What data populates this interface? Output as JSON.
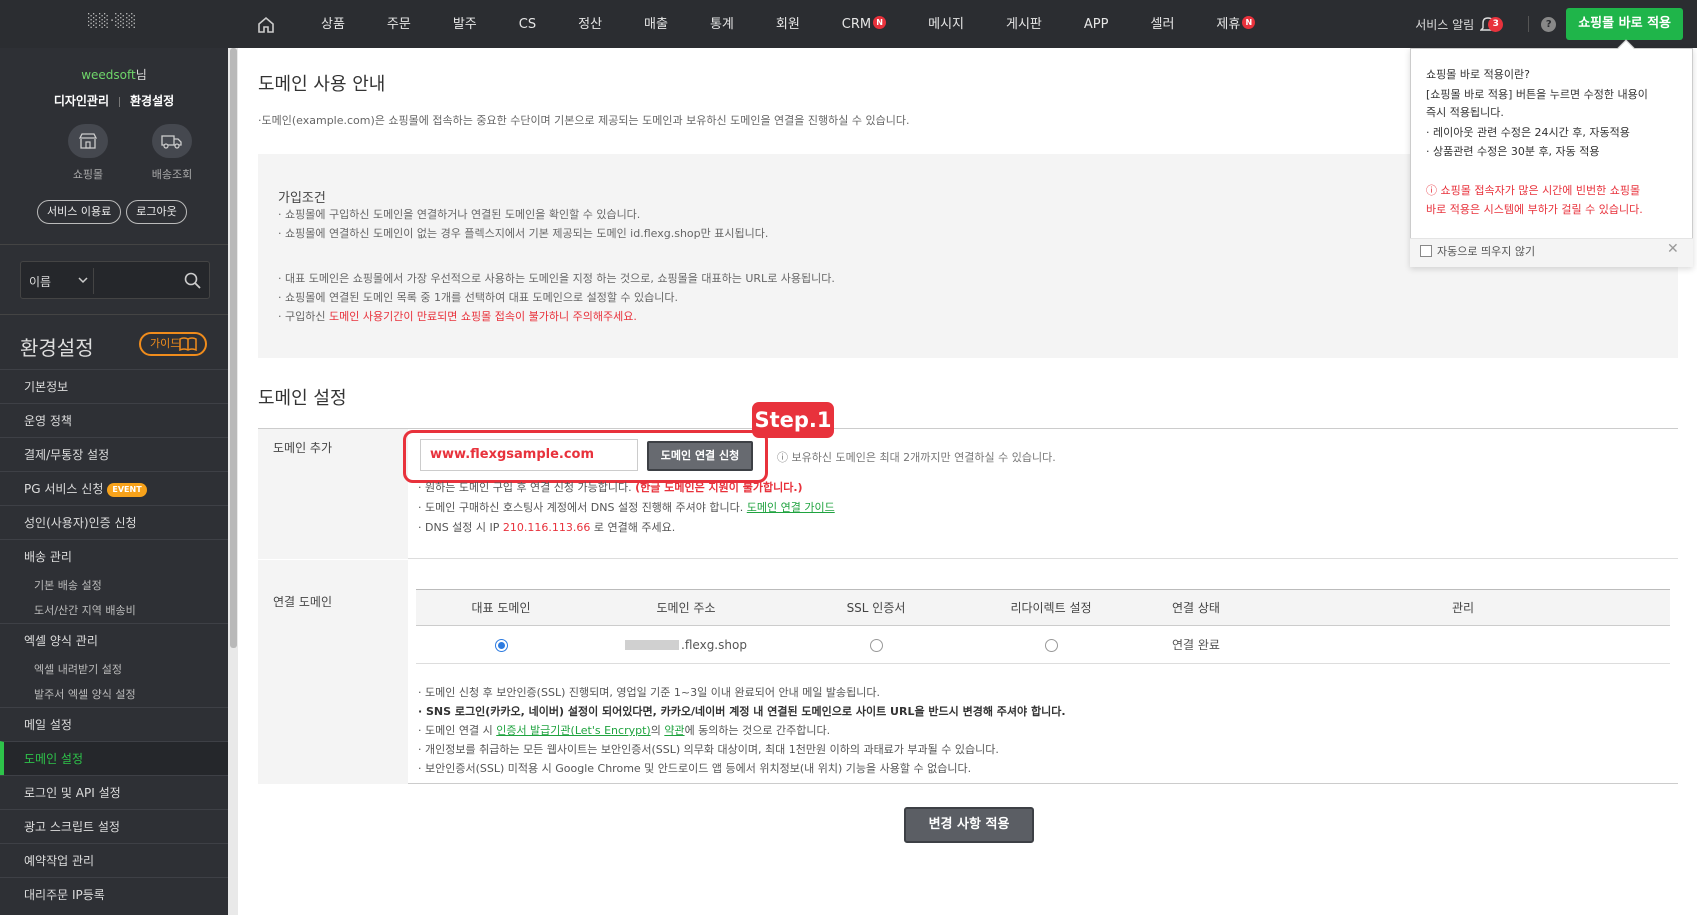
{
  "topbar": {
    "logo": "░░·░░",
    "nav": [
      {
        "label": "상품",
        "badge": ""
      },
      {
        "label": "주문",
        "badge": ""
      },
      {
        "label": "발주",
        "badge": ""
      },
      {
        "label": "CS",
        "badge": ""
      },
      {
        "label": "정산",
        "badge": ""
      },
      {
        "label": "매출",
        "badge": ""
      },
      {
        "label": "통계",
        "badge": ""
      },
      {
        "label": "회원",
        "badge": ""
      },
      {
        "label": "CRM",
        "badge": "N"
      },
      {
        "label": "메시지",
        "badge": ""
      },
      {
        "label": "게시판",
        "badge": ""
      },
      {
        "label": "APP",
        "badge": ""
      },
      {
        "label": "셀러",
        "badge": ""
      },
      {
        "label": "제휴",
        "badge": "N"
      }
    ],
    "service_alert": "서비스 알림",
    "alert_count": "3",
    "help": "?",
    "apply_label": "쇼핑몰 바로 적용"
  },
  "sidebar": {
    "user_name": "weedsoft",
    "user_suffix": "님",
    "link_design": "디자인관리",
    "link_settings": "환경설정",
    "icon_shop": "쇼핑몰",
    "icon_delivery": "배송조회",
    "btn_service": "서비스 이용료",
    "btn_logout": "로그아웃",
    "search_select": "이름",
    "section_title": "환경설정",
    "guide_label": "가이드",
    "menu": [
      {
        "label": "기본정보",
        "type": "main",
        "event": ""
      },
      {
        "label": "운영 정책",
        "type": "main",
        "event": ""
      },
      {
        "label": "결제/무통장 설정",
        "type": "main",
        "event": ""
      },
      {
        "label": "PG 서비스 신청",
        "type": "main",
        "event": "EVENT"
      },
      {
        "label": "성인(사용자)인증 신청",
        "type": "main",
        "event": ""
      },
      {
        "label": "배송 관리",
        "type": "main",
        "event": ""
      },
      {
        "label": "기본 배송 설정",
        "type": "sub",
        "event": ""
      },
      {
        "label": "도서/산간 지역 배송비",
        "type": "sub",
        "event": ""
      },
      {
        "label": "엑셀 양식 관리",
        "type": "main",
        "event": ""
      },
      {
        "label": "엑셀 내려받기 설정",
        "type": "sub",
        "event": ""
      },
      {
        "label": "발주서 엑셀 양식 설정",
        "type": "sub",
        "event": ""
      },
      {
        "label": "메일 설정",
        "type": "main",
        "event": ""
      },
      {
        "label": "도메인 설정",
        "type": "active",
        "event": ""
      },
      {
        "label": "로그인 및 API 설정",
        "type": "main",
        "event": ""
      },
      {
        "label": "광고 스크립트 설정",
        "type": "main",
        "event": ""
      },
      {
        "label": "예약작업 관리",
        "type": "main",
        "event": ""
      },
      {
        "label": "대리주문 IP등록",
        "type": "main",
        "event": ""
      }
    ]
  },
  "guide": {
    "title": "도메인 사용 안내",
    "desc": "·도메인(example.com)은 쇼핑몰에 접속하는 중요한 수단이며 기본으로 제공되는 도메인과 보유하신 도메인을 연결을 진행하실 수 있습니다.",
    "box_title": "가입조건",
    "lines": [
      "· 쇼핑몰에 구입하신 도메인을 연결하거나 연결된 도메인을 확인할 수 있습니다.",
      "· 쇼핑몰에 연결하신 도메인이 없는 경우 플렉스지에서 기본 제공되는 도메인 id.flexg.shop만 표시됩니다.",
      "· 대표 도메인은 쇼핑몰에서 가장 우선적으로 사용하는 도메인을 지정 하는 것으로, 쇼핑몰을 대표하는 URL로 사용됩니다.",
      "· 쇼핑몰에 연결된 도메인 목록 중 1개를 선택하여 대표 도메인으로 설정할 수 있습니다."
    ],
    "warn_prefix": "· 구입하신 ",
    "warn_red": "도메인 사용기간이 만료되면 쇼핑몰 접속이 불가하니 주의해주세요."
  },
  "domain_settings": {
    "title": "도메인 설정",
    "add_label": "도메인 추가",
    "step_tag": "Step.1",
    "domain_value": "www.flexgsample.com",
    "connect_button": "도메인 연결 신청",
    "max_note": "ⓘ 보유하신 도메인은 최대 2개까지만 연결하실 수 있습니다.",
    "note1_a": "· 원하는 도메인 구입 후 연결 신청 가능합니다. ",
    "note1_red": "(한글 도메인은 지원이 불가합니다.)",
    "note2_a": "· 도메인 구매하신 호스팅사 계정에서 DNS 설정 진행해 주셔야 합니다.  ",
    "note2_link": "도메인 연결 가이드",
    "note3_a": "· DNS 설정 시 IP ",
    "note3_ip": "210.116.113.66",
    "note3_b": " 로 연결해 주세요.",
    "connected_label": "연결 도메인",
    "columns": [
      "대표 도메인",
      "도메인 주소",
      "SSL 인증서",
      "리다이렉트 설정",
      "연결 상태",
      "관리"
    ],
    "row": {
      "address": ".flexg.shop",
      "status": "연결 완료"
    },
    "ssl_note1": "· 도메인 신청 후 보안인증(SSL) 진행되며, 영업일 기준 1~3일 이내 완료되어 안내 메일 발송됩니다.",
    "ssl_note2": "· SNS 로그인(카카오, 네이버) 설정이 되어있다면, 카카오/네이버 계정 내 연결된 도메인으로 사이트 URL을 반드시 변경해 주셔야 합니다.",
    "ssl_note3_a": "· 도메인 연결 시 ",
    "ssl_note3_link1": "인증서 발급기관(Let's Encrypt)",
    "ssl_note3_b": "의 ",
    "ssl_note3_link2": "약관",
    "ssl_note3_c": "에 동의하는 것으로 간주합니다.",
    "ssl_note4": "· 개인정보를 취급하는 모든 웹사이트는 보안인증서(SSL) 의무화 대상이며, 최대 1천만원 이하의 과태료가 부과될 수 있습니다.",
    "ssl_note5": "· 보안인증서(SSL) 미적용 시 Google Chrome 및 안드로이드 앱 등에서 위치정보(내 위치) 기능을 사용할 수 없습니다.",
    "apply_button": "변경 사항 적용"
  },
  "popover": {
    "title": "쇼핑몰 바로 적용이란?",
    "line1": "[쇼핑몰 바로 적용] 버튼을 누르면 수정한 내용이",
    "line2": "즉시 적용됩니다.",
    "line3": "· 레이아웃 관련 수정은 24시간 후, 자동적용",
    "line4": "· 상품관련 수정은 30분 후, 자동 적용",
    "warn1": "ⓘ 쇼핑몰 접속자가 많은 시간에 빈번한 쇼핑몰",
    "warn2": "바로 적용은 시스템에 부하가 걸릴 수 있습니다.",
    "checkbox_label": "자동으로 띄우지 않기",
    "close": "✕"
  }
}
